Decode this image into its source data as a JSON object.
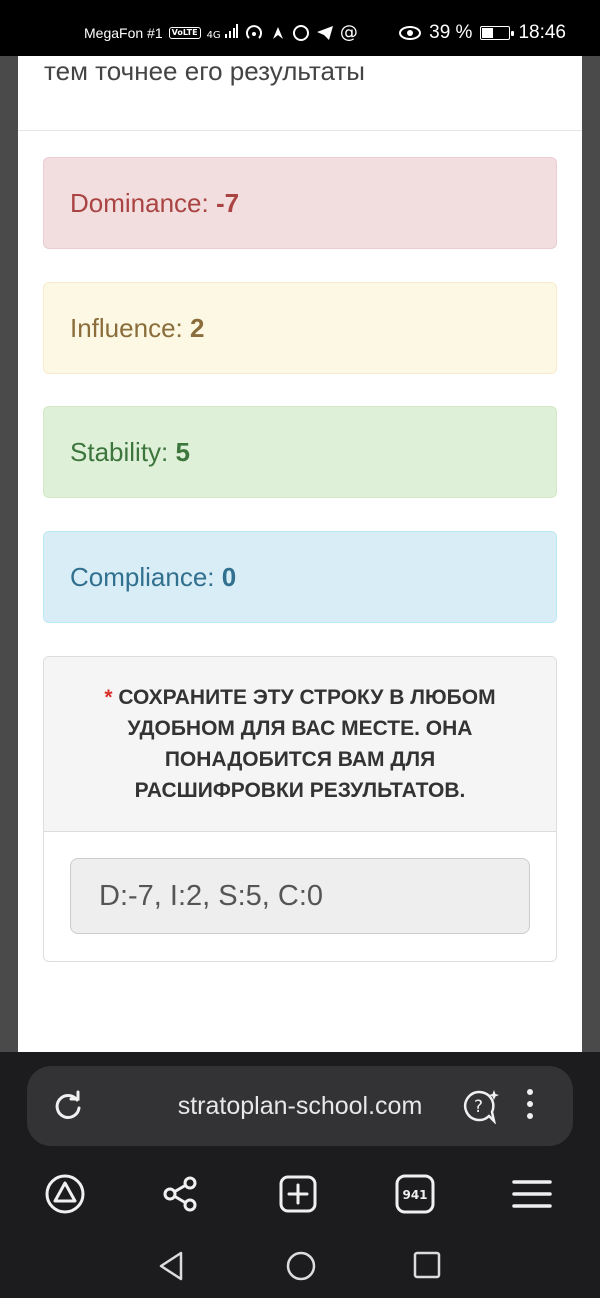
{
  "status_bar": {
    "carrier": "MegaFon #1",
    "volte": "VoLTE",
    "network": "4G",
    "battery_percent": "39 %",
    "battery_level": 0.39,
    "time": "18:46"
  },
  "page": {
    "intro_text": "тем точнее его результаты",
    "results": [
      {
        "label": "Dominance:",
        "value": "-7"
      },
      {
        "label": "Influence:",
        "value": "2"
      },
      {
        "label": "Stability:",
        "value": "5"
      },
      {
        "label": "Compliance:",
        "value": "0"
      }
    ],
    "save_panel": {
      "asterisk": "*",
      "notice": "СОХРАНИТЕ ЭТУ СТРОКУ В ЛЮБОМ УДОБНОМ ДЛЯ ВАС МЕСТЕ. ОНА ПОНАДОБИТСЯ ВАМ ДЛЯ РАСШИФРОВКИ РЕЗУЛЬТАТОВ.",
      "code_value": "D:-7, I:2, S:5, C:0"
    }
  },
  "browser": {
    "url": "stratoplan-school.com",
    "tab_count": "941",
    "icons": [
      "reload-icon",
      "assistant-icon",
      "more-menu-icon",
      "home-icon",
      "share-icon",
      "new-tab-icon",
      "tabs-icon",
      "menu-icon",
      "back-icon",
      "home-circle-icon",
      "recents-icon"
    ]
  },
  "colors": {
    "dominance": "#a94442",
    "influence": "#8a6d3b",
    "stability": "#3c763d",
    "compliance": "#31708f"
  }
}
